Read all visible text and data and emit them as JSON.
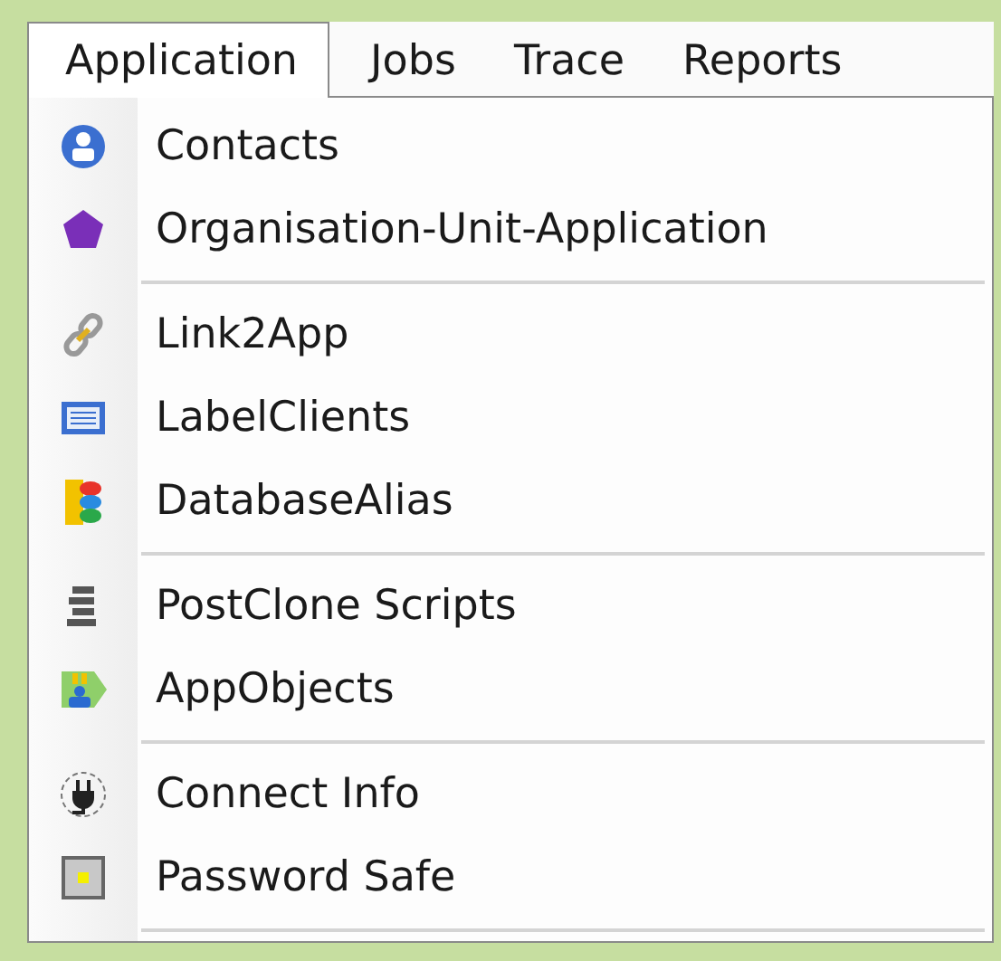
{
  "menu_bar": [
    {
      "label": "Application",
      "selected": true
    },
    {
      "label": "Jobs",
      "selected": false
    },
    {
      "label": "Trace",
      "selected": false
    },
    {
      "label": "Reports",
      "selected": false
    }
  ],
  "menu": {
    "groups": [
      [
        {
          "label": "Contacts",
          "kind": "person"
        },
        {
          "label": "Organisation-Unit-Application",
          "kind": "pentagon"
        }
      ],
      [
        {
          "label": "Link2App",
          "kind": "chain"
        },
        {
          "label": "LabelClients",
          "kind": "list"
        },
        {
          "label": "DatabaseAlias",
          "kind": "database"
        }
      ],
      [
        {
          "label": "PostClone Scripts",
          "kind": "stack"
        },
        {
          "label": "AppObjects",
          "kind": "objects"
        }
      ],
      [
        {
          "label": "Connect Info",
          "kind": "plug"
        },
        {
          "label": "Password Safe",
          "kind": "safe"
        }
      ]
    ]
  }
}
